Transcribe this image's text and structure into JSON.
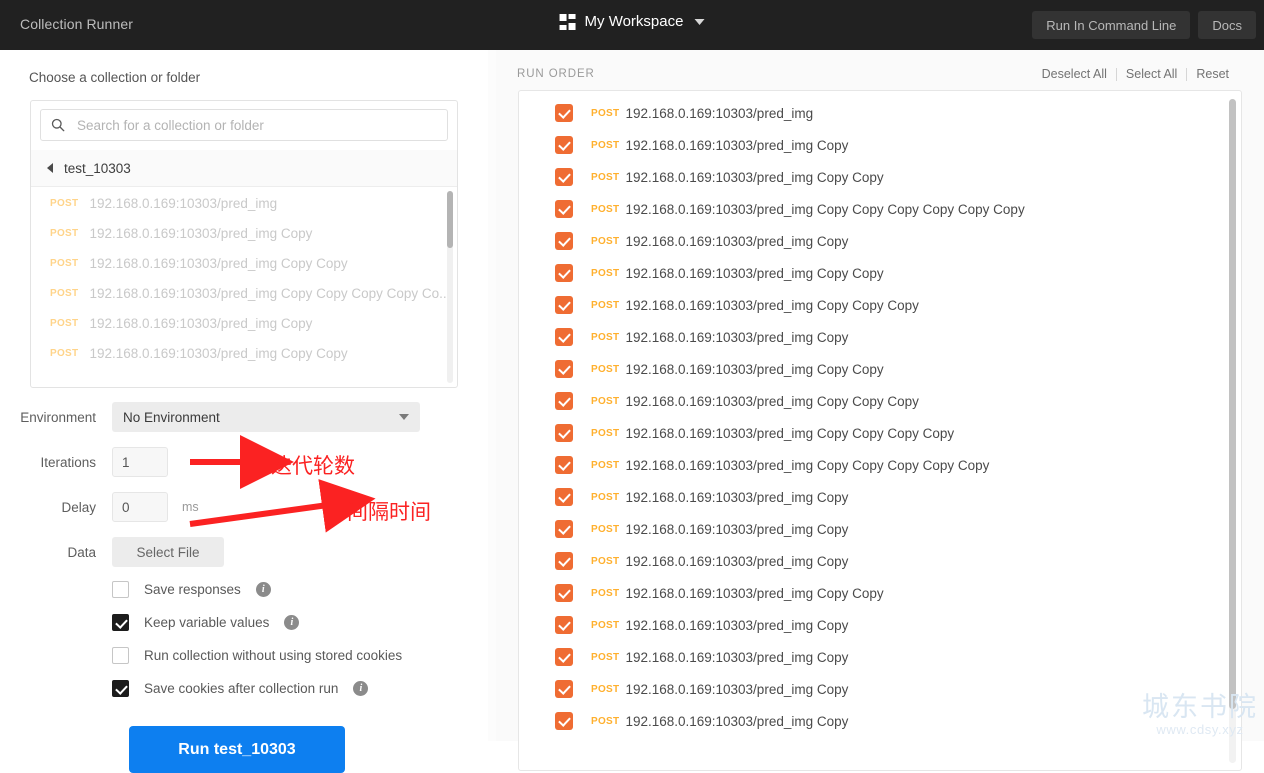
{
  "topbar": {
    "title": "Collection Runner",
    "workspace_icon": "grid-icon",
    "workspace_label": "My Workspace",
    "workspace_caret": "chevron-down-icon",
    "run_in_command_line": "Run In Command Line",
    "docs": "Docs",
    "bg_color": "#212121"
  },
  "left": {
    "choose_label": "Choose a collection or folder",
    "search": {
      "icon": "search-icon",
      "value": "",
      "placeholder": "Search for a collection or folder"
    },
    "breadcrumb": {
      "back_icon": "back-triangle-icon",
      "name": "test_10303"
    },
    "requests": [
      {
        "method": "POST",
        "name": "192.168.0.169:10303/pred_img"
      },
      {
        "method": "POST",
        "name": "192.168.0.169:10303/pred_img Copy"
      },
      {
        "method": "POST",
        "name": "192.168.0.169:10303/pred_img Copy Copy"
      },
      {
        "method": "POST",
        "name": "192.168.0.169:10303/pred_img Copy Copy Copy Copy Co..."
      },
      {
        "method": "POST",
        "name": "192.168.0.169:10303/pred_img Copy"
      },
      {
        "method": "POST",
        "name": "192.168.0.169:10303/pred_img Copy Copy"
      }
    ],
    "form": {
      "environment_label": "Environment",
      "environment_value": "No Environment",
      "iterations_label": "Iterations",
      "iterations_value": "1",
      "delay_label": "Delay",
      "delay_value": "0",
      "delay_unit": "ms",
      "data_label": "Data",
      "select_file_label": "Select File"
    },
    "options": [
      {
        "label": "Save responses",
        "checked": false,
        "info": true
      },
      {
        "label": "Keep variable values",
        "checked": true,
        "info": true
      },
      {
        "label": "Run collection without using stored cookies",
        "checked": false,
        "info": false
      },
      {
        "label": "Save cookies after collection run",
        "checked": true,
        "info": true
      }
    ],
    "run_button_label": "Run test_10303",
    "run_button_color": "#0d7ff0"
  },
  "annotations": {
    "color": "#fb2222",
    "iterations_note": "迭代轮数",
    "delay_note": "间隔时间"
  },
  "right": {
    "run_order_label": "RUN ORDER",
    "deselect_all": "Deselect All",
    "select_all": "Select All",
    "reset": "Reset",
    "checkbox_color": "#ef6c33",
    "method_color": "#ffb02e",
    "items": [
      {
        "checked": true,
        "method": "POST",
        "name": "192.168.0.169:10303/pred_img"
      },
      {
        "checked": true,
        "method": "POST",
        "name": "192.168.0.169:10303/pred_img Copy"
      },
      {
        "checked": true,
        "method": "POST",
        "name": "192.168.0.169:10303/pred_img Copy Copy"
      },
      {
        "checked": true,
        "method": "POST",
        "name": "192.168.0.169:10303/pred_img Copy Copy Copy Copy Copy Copy"
      },
      {
        "checked": true,
        "method": "POST",
        "name": "192.168.0.169:10303/pred_img Copy"
      },
      {
        "checked": true,
        "method": "POST",
        "name": "192.168.0.169:10303/pred_img Copy Copy"
      },
      {
        "checked": true,
        "method": "POST",
        "name": "192.168.0.169:10303/pred_img Copy Copy Copy"
      },
      {
        "checked": true,
        "method": "POST",
        "name": "192.168.0.169:10303/pred_img Copy"
      },
      {
        "checked": true,
        "method": "POST",
        "name": "192.168.0.169:10303/pred_img Copy Copy"
      },
      {
        "checked": true,
        "method": "POST",
        "name": "192.168.0.169:10303/pred_img Copy Copy Copy"
      },
      {
        "checked": true,
        "method": "POST",
        "name": "192.168.0.169:10303/pred_img Copy Copy Copy Copy"
      },
      {
        "checked": true,
        "method": "POST",
        "name": "192.168.0.169:10303/pred_img Copy Copy Copy Copy Copy"
      },
      {
        "checked": true,
        "method": "POST",
        "name": "192.168.0.169:10303/pred_img Copy"
      },
      {
        "checked": true,
        "method": "POST",
        "name": "192.168.0.169:10303/pred_img Copy"
      },
      {
        "checked": true,
        "method": "POST",
        "name": "192.168.0.169:10303/pred_img Copy"
      },
      {
        "checked": true,
        "method": "POST",
        "name": "192.168.0.169:10303/pred_img Copy Copy"
      },
      {
        "checked": true,
        "method": "POST",
        "name": "192.168.0.169:10303/pred_img Copy"
      },
      {
        "checked": true,
        "method": "POST",
        "name": "192.168.0.169:10303/pred_img Copy"
      },
      {
        "checked": true,
        "method": "POST",
        "name": "192.168.0.169:10303/pred_img Copy"
      },
      {
        "checked": true,
        "method": "POST",
        "name": "192.168.0.169:10303/pred_img Copy"
      }
    ]
  },
  "watermark": {
    "cn": "城东书院",
    "url": "www.cdsy.xyz"
  }
}
